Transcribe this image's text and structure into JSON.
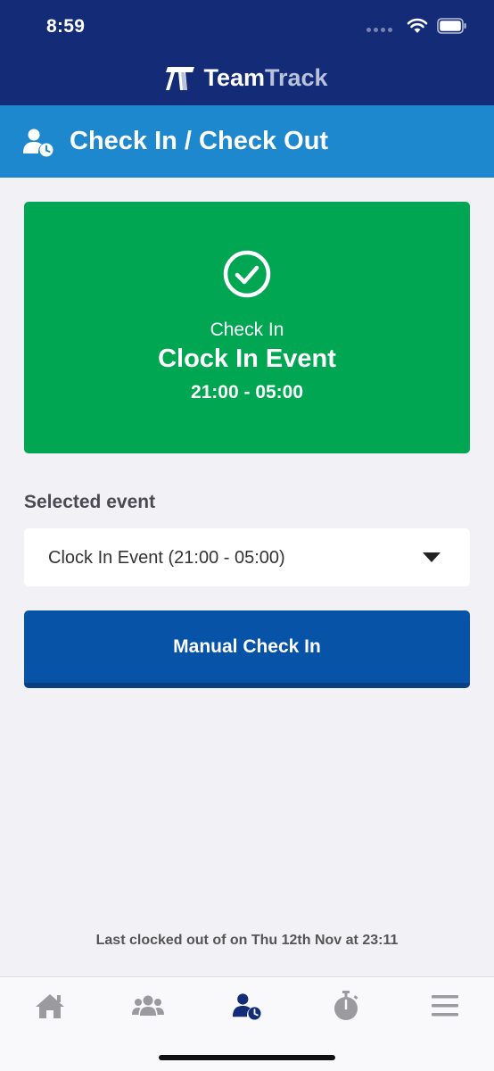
{
  "status_bar": {
    "time": "8:59",
    "icons": [
      "signal-dots-icon",
      "wifi-icon",
      "battery-icon"
    ]
  },
  "brand": {
    "name_part1": "Team",
    "name_part2": "Track",
    "logo_icon": "teamtrack-logo-icon"
  },
  "header": {
    "title": "Check In / Check Out",
    "icon": "user-clock-icon"
  },
  "status_card": {
    "icon": "check-circle-icon",
    "label": "Check In",
    "event_name": "Clock In Event",
    "time_range": "21:00 - 05:00",
    "color": "#00a651"
  },
  "event_select": {
    "label": "Selected event",
    "value": "Clock In Event (21:00 - 05:00)"
  },
  "actions": {
    "manual_check_in": "Manual Check In"
  },
  "footer": {
    "last_clocked": "Last clocked out of on Thu 12th Nov at 23:11"
  },
  "tab_bar": {
    "tabs": [
      {
        "icon": "home-icon",
        "active": false
      },
      {
        "icon": "users-icon",
        "active": false
      },
      {
        "icon": "user-clock-icon",
        "active": true
      },
      {
        "icon": "stopwatch-icon",
        "active": false
      },
      {
        "icon": "menu-icon",
        "active": false
      }
    ],
    "active_color": "#142c78",
    "inactive_color": "#9a9a9f"
  }
}
